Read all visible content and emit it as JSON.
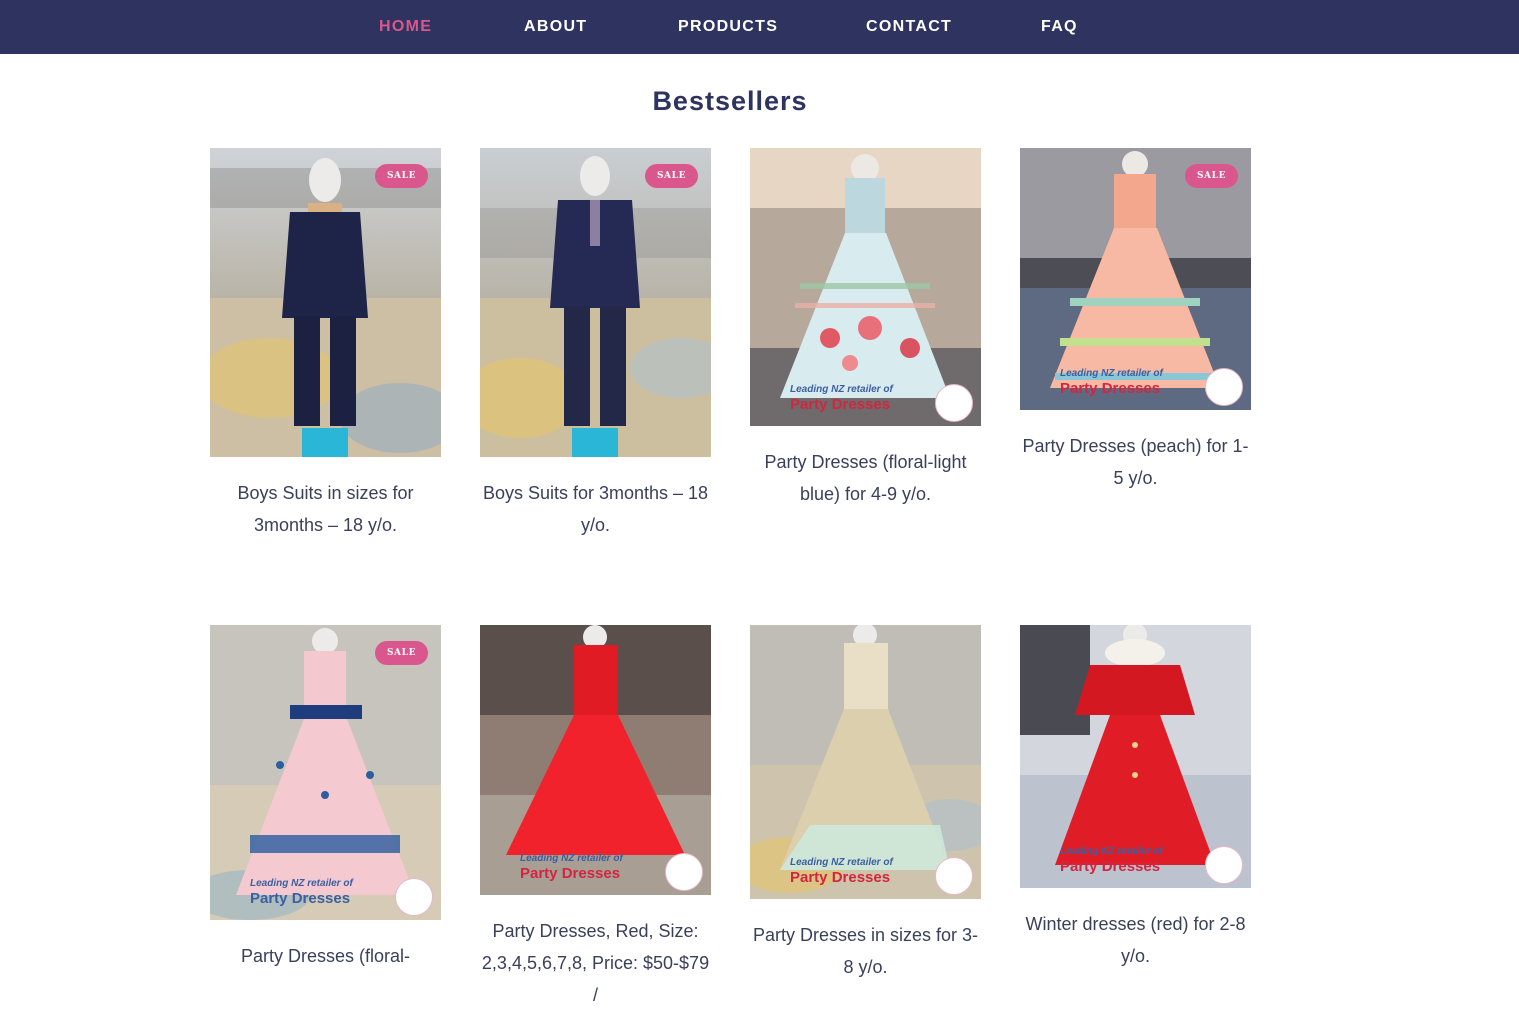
{
  "nav": {
    "items": [
      {
        "label": "HOME",
        "active": true
      },
      {
        "label": "ABOUT"
      },
      {
        "label": "PRODUCTS"
      },
      {
        "label": "CONTACT"
      },
      {
        "label": "FAQ"
      }
    ]
  },
  "section": {
    "title": "Bestsellers"
  },
  "badge_label": "SALE",
  "logo": {
    "line1": "Leading NZ retailer of",
    "line2": "Party Dresses"
  },
  "products": [
    {
      "name": "Boys Suits in sizes for 3months – 18 y/o.",
      "sale": true
    },
    {
      "name": "Boys Suits for 3months – 18 y/o.",
      "sale": true
    },
    {
      "name": "Party Dresses (floral-light blue) for 4-9 y/o.",
      "sale": false
    },
    {
      "name": "Party Dresses (peach) for 1-5 y/o.",
      "sale": true
    },
    {
      "name": "Party Dresses (floral-",
      "sale": true
    },
    {
      "name": "Party Dresses, Red, Size: 2,3,4,5,6,7,8, Price: $50-$79 /",
      "sale": false
    },
    {
      "name": "Party Dresses in sizes for 3-8 y/o.",
      "sale": false
    },
    {
      "name": "Winter dresses (red) for 2-8 y/o.",
      "sale": false
    }
  ],
  "colors": {
    "nav_bg": "#2e3360",
    "accent": "#d9578c",
    "title": "#2e3360",
    "caption": "#39405a"
  }
}
